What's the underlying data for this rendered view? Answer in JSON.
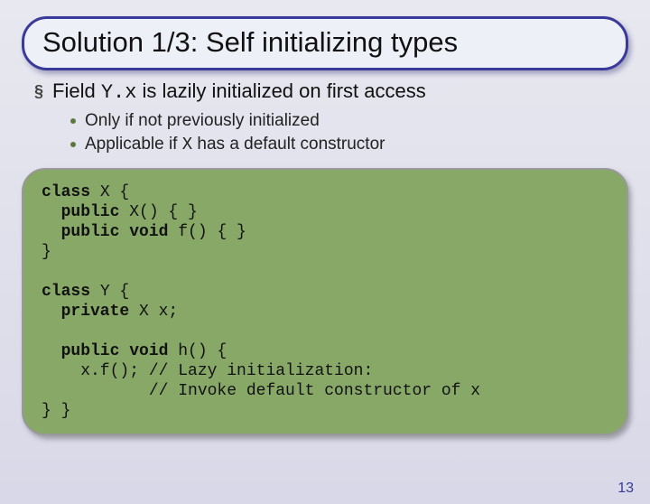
{
  "title": "Solution 1/3: Self initializing types",
  "bullets": {
    "l1": {
      "prefix": "Field ",
      "code": "Y.x",
      "suffix": " is lazily initialized on first access"
    },
    "l2a": "Only if not previously initialized",
    "l2b_prefix": "Applicable if ",
    "l2b_code": "X",
    "l2b_suffix": " has a default constructor"
  },
  "code": {
    "l01a": "class",
    "l01b": " X {",
    "l02a": "  public",
    "l02b": " X() { }",
    "l03a": "  public void",
    "l03b": " f() { }",
    "l04": "}",
    "blank1": "",
    "l05a": "class",
    "l05b": " Y {",
    "l06a": "  private",
    "l06b": " X x;",
    "blank2": "",
    "l07a": "  public void",
    "l07b": " h() {",
    "l08": "    x.f(); // Lazy initialization:",
    "l09": "           // Invoke default constructor of x",
    "l10": "} }"
  },
  "page": "13"
}
